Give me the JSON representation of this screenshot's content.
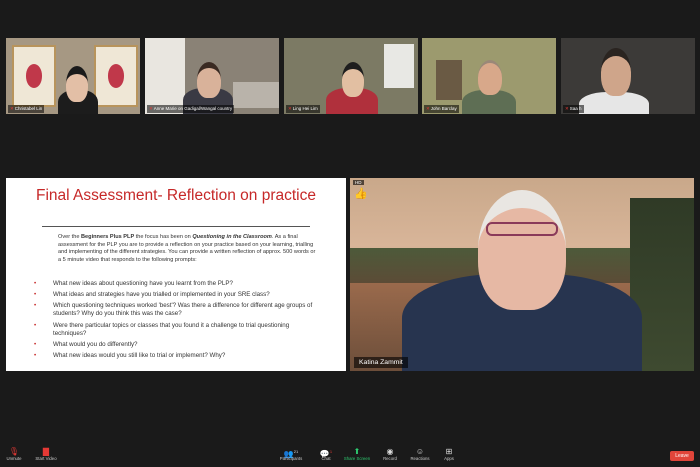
{
  "participants": [
    {
      "name": "Christabel Lin"
    },
    {
      "name": "Anne Marie on Gadigal/Wangal country"
    },
    {
      "name": "Ling Hei Lim"
    },
    {
      "name": "John Barclay"
    },
    {
      "name": "Saa h"
    }
  ],
  "slide": {
    "title": "Final Assessment- Reflection on practice",
    "intro_parts": [
      "Over the ",
      "Beginners Plus PLP",
      " the focus has been on ",
      "Questioning in the Classroom",
      ". As a final assessment for the PLP you are to provide a reflection on your practice based on your learning, trialling and implementing of the different strategies. You can provide a written reflection of approx. 500 words or a 5 minute video that responds to the following prompts:"
    ],
    "prompts": [
      "What new ideas about questioning have you learnt from the PLP?",
      "What ideas and strategies have you trialled or implemented in your SRE class?",
      "Which questioning techniques worked 'best'? Was there a difference for different age groups of students? Why do you think this was the case?",
      "Were there particular topics or classes that you found it a challenge to trial questioning techniques?",
      "What would you do differently?",
      "What new ideas would you still like to trial or implement? Why?"
    ]
  },
  "speaker": {
    "name": "Katina Zammit",
    "badge": "HD",
    "reaction": "👍"
  },
  "toolbar": {
    "unmute": "Unmute",
    "start_video": "Start Video",
    "participants": "Participants",
    "participants_count": "21",
    "chat": "Chat",
    "chat_badge": "1",
    "share_screen": "Share Screen",
    "record": "Record",
    "reactions": "Reactions",
    "apps": "Apps",
    "leave": "Leave"
  },
  "colors": {
    "title": "#c62828",
    "share": "#2ecc71",
    "leave": "#e0453a"
  }
}
